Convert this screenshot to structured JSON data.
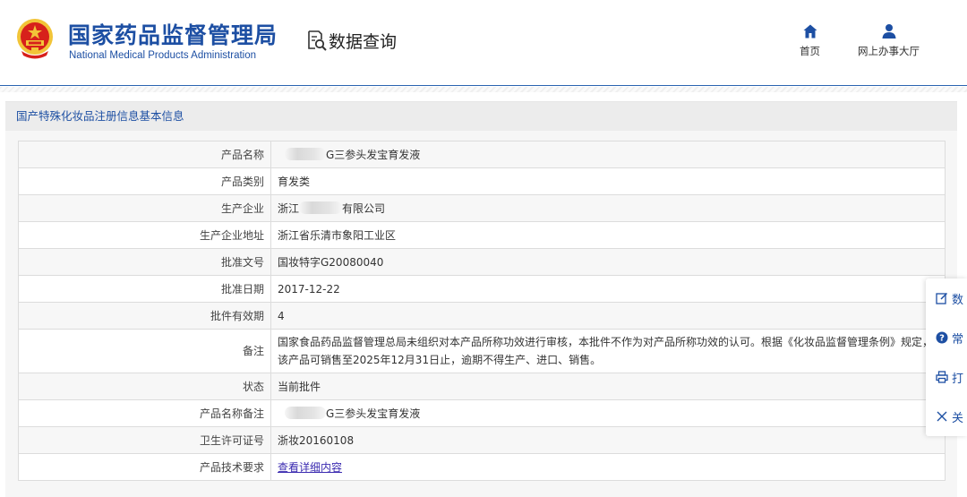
{
  "header": {
    "org_name_cn": "国家药品监督管理局",
    "org_name_en": "National Medical Products Administration",
    "section_title": "数据查询",
    "nav": [
      {
        "label": "首页",
        "icon": "home-icon"
      },
      {
        "label": "网上办事大厅",
        "icon": "user-icon"
      }
    ]
  },
  "panel": {
    "title": "国产特殊化妆品注册信息基本信息"
  },
  "record": {
    "rows": [
      {
        "key": "产品名称",
        "value": "G三参头发宝育发液",
        "redacted_prefix": true
      },
      {
        "key": "产品类别",
        "value": "育发类"
      },
      {
        "key": "生产企业",
        "value_prefix": "浙江",
        "value": "有限公司",
        "redacted_middle": true
      },
      {
        "key": "生产企业地址",
        "value": "浙江省乐清市象阳工业区"
      },
      {
        "key": "批准文号",
        "value": "国妆特字G20080040"
      },
      {
        "key": "批准日期",
        "value": "2017-12-22"
      },
      {
        "key": "批件有效期",
        "value": "4"
      },
      {
        "key": "备注",
        "value": "国家食品药品监督管理总局未组织对本产品所称功效进行审核，本批件不作为对产品所称功效的认可。根据《化妆品监督管理条例》规定，该产品可销售至2025年12月31日止，逾期不得生产、进口、销售。"
      },
      {
        "key": "状态",
        "value": "当前批件"
      },
      {
        "key": "产品名称备注",
        "value": "G三参头发宝育发液",
        "redacted_prefix": true
      },
      {
        "key": "卫生许可证号",
        "value": "浙妆20160108"
      },
      {
        "key": "产品技术要求",
        "value": "查看详细内容",
        "is_link": true
      }
    ]
  },
  "side_toolbar": {
    "items": [
      {
        "label": "数",
        "icon": "edit-icon"
      },
      {
        "label": "常",
        "icon": "help-icon"
      },
      {
        "label": "打",
        "icon": "print-icon"
      },
      {
        "label": "关",
        "icon": "close-icon"
      }
    ]
  },
  "colors": {
    "brand_blue": "#1d4fa3",
    "link_purple": "#3b2bb0",
    "emblem_red": "#d7201b",
    "emblem_gold": "#f2c438"
  }
}
